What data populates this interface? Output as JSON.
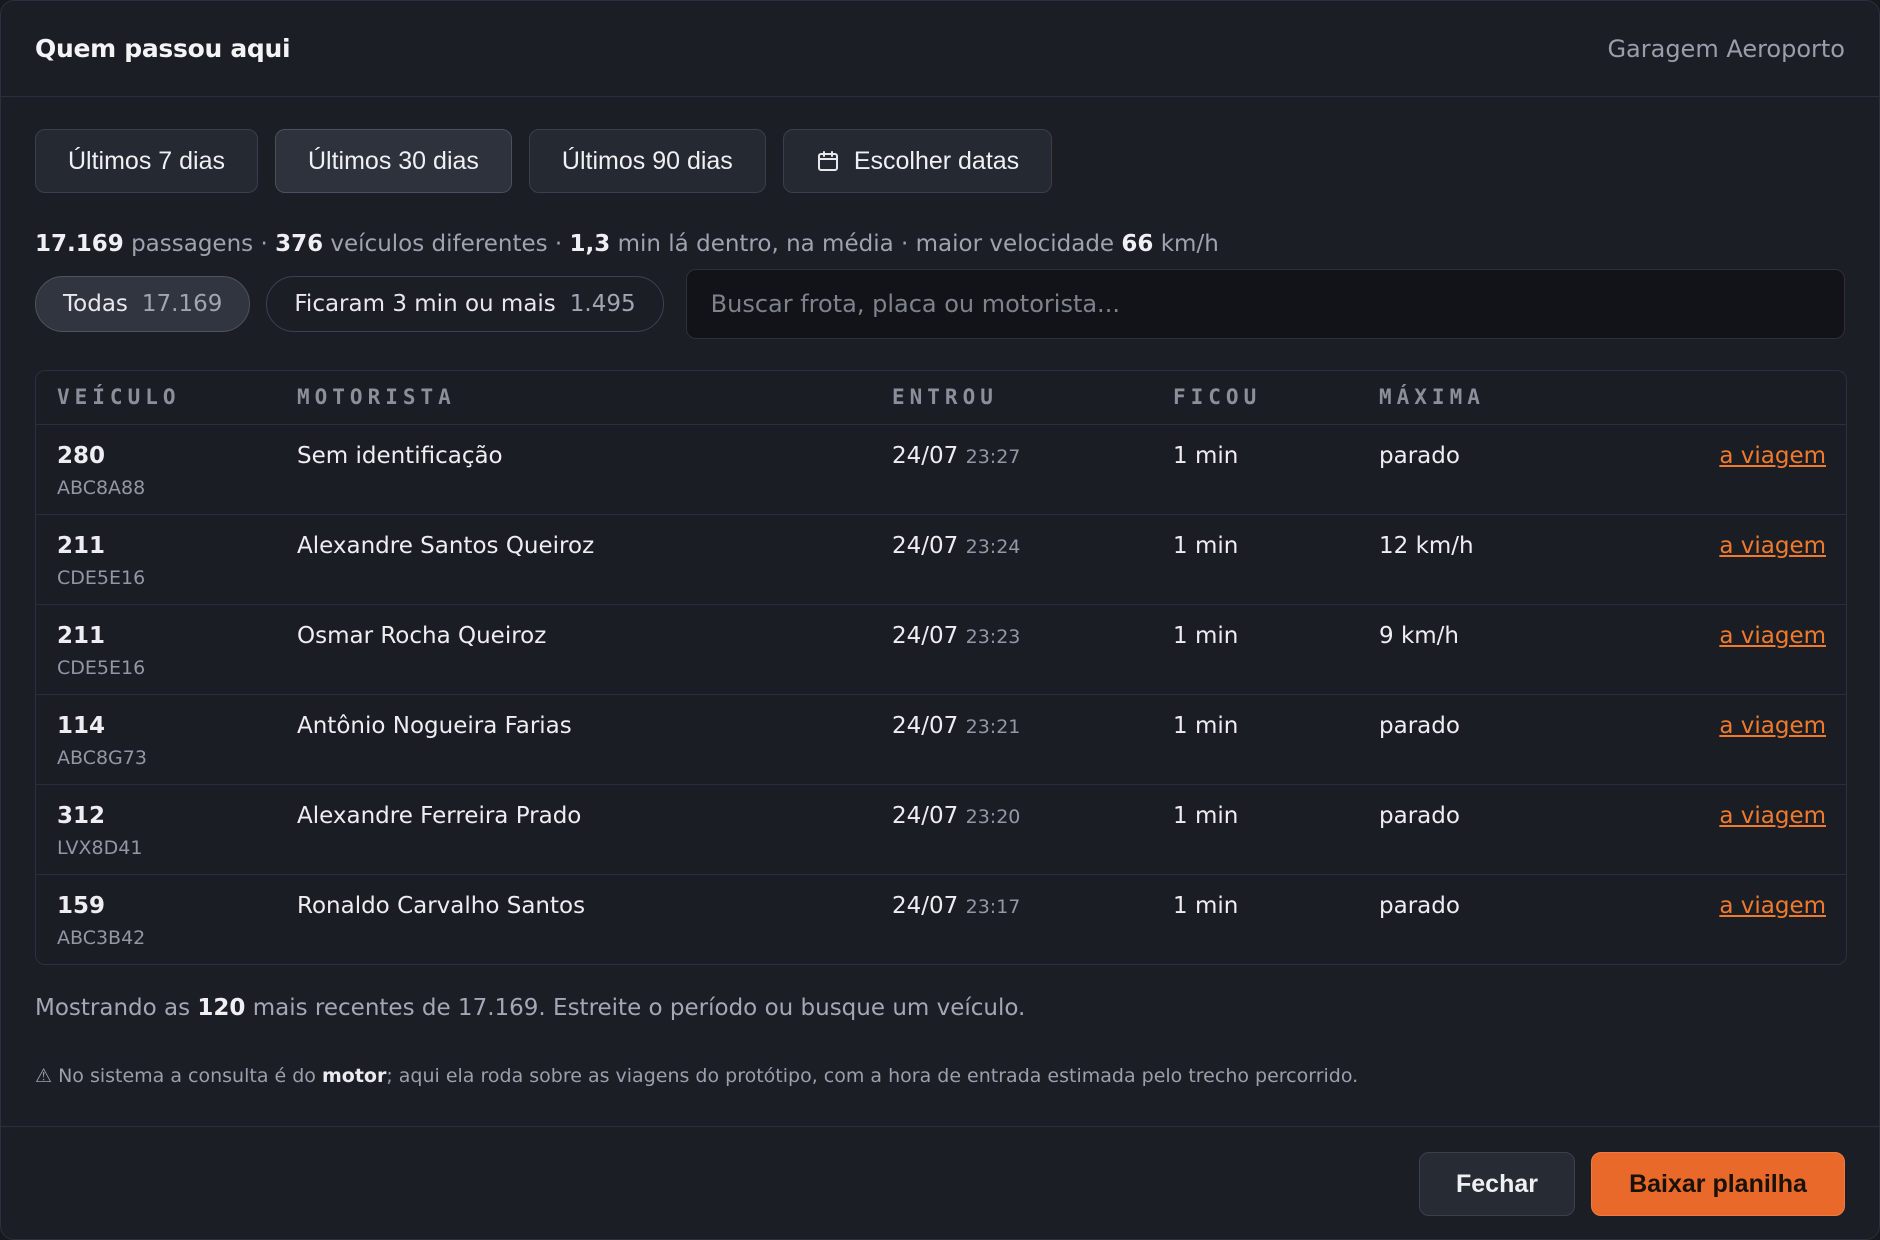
{
  "header": {
    "title": "Quem passou aqui",
    "subtitle": "Garagem Aeroporto"
  },
  "periods": [
    {
      "label": "Últimos 7 dias"
    },
    {
      "label": "Últimos 30 dias"
    },
    {
      "label": "Últimos 90 dias"
    },
    {
      "label": "Escolher datas",
      "icon": "calendar-icon"
    }
  ],
  "stats": {
    "passages": "17.169",
    "passages_label": "passagens ·",
    "vehicles": "376",
    "vehicles_label": "veículos diferentes ·",
    "avg": "1,3",
    "avg_label": "min lá dentro, na média · maior velocidade",
    "max_speed": "66",
    "speed_unit": "km/h"
  },
  "filters": [
    {
      "label": "Todas",
      "count": "17.169"
    },
    {
      "label": "Ficaram 3 min ou mais",
      "count": "1.495"
    }
  ],
  "search": {
    "placeholder": "Buscar frota, placa ou motorista...",
    "value": ""
  },
  "table": {
    "headers": [
      "VEÍCULO",
      "MOTORISTA",
      "ENTROU",
      "FICOU",
      "MÁXIMA"
    ],
    "rows": [
      {
        "fleet": "280",
        "plate": "ABC8A88",
        "driver": "Sem identificação",
        "date": "24/07",
        "time": "23:27",
        "stay": "1 min",
        "max": "parado",
        "link": "a viagem"
      },
      {
        "fleet": "211",
        "plate": "CDE5E16",
        "driver": "Alexandre Santos Queiroz",
        "date": "24/07",
        "time": "23:24",
        "stay": "1 min",
        "max": "12 km/h",
        "link": "a viagem"
      },
      {
        "fleet": "211",
        "plate": "CDE5E16",
        "driver": "Osmar Rocha Queiroz",
        "date": "24/07",
        "time": "23:23",
        "stay": "1 min",
        "max": "9 km/h",
        "link": "a viagem"
      },
      {
        "fleet": "114",
        "plate": "ABC8G73",
        "driver": "Antônio Nogueira Farias",
        "date": "24/07",
        "time": "23:21",
        "stay": "1 min",
        "max": "parado",
        "link": "a viagem"
      },
      {
        "fleet": "312",
        "plate": "LVX8D41",
        "driver": "Alexandre Ferreira Prado",
        "date": "24/07",
        "time": "23:20",
        "stay": "1 min",
        "max": "parado",
        "link": "a viagem"
      },
      {
        "fleet": "159",
        "plate": "ABC3B42",
        "driver": "Ronaldo Carvalho Santos",
        "date": "24/07",
        "time": "23:17",
        "stay": "1 min",
        "max": "parado",
        "link": "a viagem"
      }
    ]
  },
  "showing": {
    "prefix": "Mostrando as",
    "count": "120",
    "suffix": "mais recentes de 17.169. Estreite o período ou busque um veículo."
  },
  "warning": {
    "prefix": "⚠ No sistema a consulta é do",
    "bold": "motor",
    "suffix": "; aqui ela roda sobre as viagens do protótipo, com a hora de entrada estimada pelo trecho percorrido."
  },
  "footer": {
    "close_label": "Fechar",
    "download_label": "Baixar planilha"
  },
  "colors": {
    "accent": "#e8692a",
    "link": "#f07a2c",
    "background": "#1b1e25"
  }
}
